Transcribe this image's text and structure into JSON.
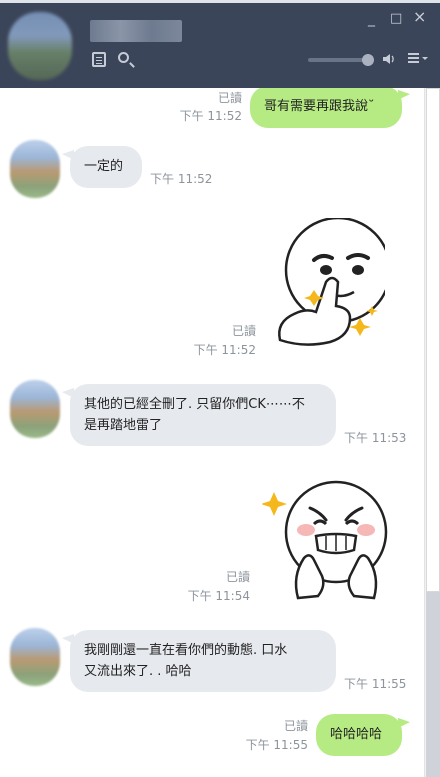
{
  "window": {
    "contact_name": "",
    "controls": {
      "minimize": "_",
      "maximize": "□",
      "close": "×"
    },
    "volume_level": 0.9,
    "icons": {
      "notes": "notes-icon",
      "search": "search-icon",
      "speaker": "speaker-icon",
      "menu": "menu-icon"
    }
  },
  "colors": {
    "header_bg": "#3b4559",
    "incoming_bubble": "#e6e9ee",
    "outgoing_bubble": "#b6eb84",
    "meta_text": "#8d949c"
  },
  "messages": [
    {
      "direction": "out",
      "type": "text",
      "text": "哥有需要再跟我說˘",
      "read": "已讀",
      "time": "下午 11:52"
    },
    {
      "direction": "in",
      "type": "text",
      "text": "一定的",
      "time": "下午 11:52"
    },
    {
      "direction": "out",
      "type": "sticker",
      "sticker": "smug-thumbs-up-sticker",
      "read": "已讀",
      "time": "下午 11:52"
    },
    {
      "direction": "in",
      "type": "text",
      "line1": "其他的已經全刪了. 只留你們CK⋯⋯不",
      "line2": "是再踏地雷了",
      "time": "下午 11:53"
    },
    {
      "direction": "out",
      "type": "sticker",
      "sticker": "giggling-face-sticker",
      "read": "已讀",
      "time": "下午 11:54"
    },
    {
      "direction": "in",
      "type": "text",
      "line1": "我剛剛還一直在看你們的動態. 口水",
      "line2": "又流出來了. . 哈哈",
      "time": "下午 11:55"
    },
    {
      "direction": "out",
      "type": "text",
      "text": "哈哈哈哈",
      "read": "已讀",
      "time": "下午 11:55"
    }
  ]
}
